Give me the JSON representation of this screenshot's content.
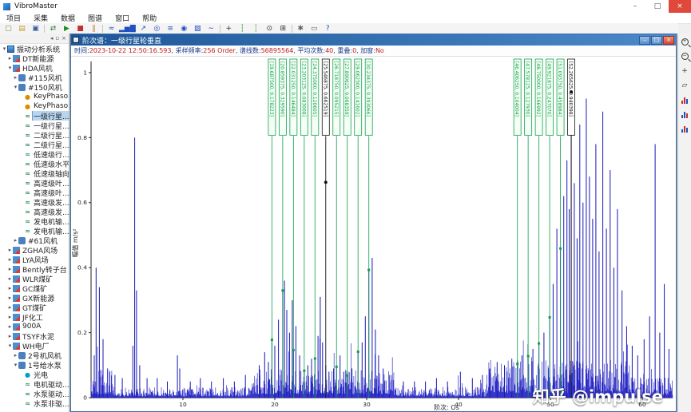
{
  "app": {
    "title": "VibroMaster"
  },
  "icons": {
    "minimize": "–",
    "maximize": "□",
    "close": "×",
    "expand_open": "▾",
    "expand_closed": "▸"
  },
  "menu": {
    "items": [
      "项目",
      "采集",
      "数据",
      "图谱",
      "窗口",
      "帮助"
    ]
  },
  "toolbar": {
    "items": [
      {
        "name": "new-project-icon",
        "glyph": "▢",
        "color": "#8a7a4a"
      },
      {
        "name": "open-project-icon",
        "glyph": "▤",
        "color": "#c89a3a"
      },
      {
        "name": "save-icon",
        "glyph": "▣",
        "color": "#3a5a9a"
      },
      {
        "sep": true
      },
      {
        "name": "connect-device-icon",
        "glyph": "⇄",
        "color": "#2a7a3a"
      },
      {
        "name": "start-acquisition-icon",
        "glyph": "▶",
        "color": "#1f8f1f"
      },
      {
        "name": "stop-acquisition-icon",
        "glyph": "■",
        "color": "#c03030"
      },
      {
        "name": "pause-acquisition-icon",
        "glyph": "‖",
        "color": "#c08030"
      },
      {
        "sep": true
      },
      {
        "name": "waveform-chart-icon",
        "glyph": "≈",
        "color": "#2050c0"
      },
      {
        "name": "spectrum-chart-icon",
        "glyph": "▂▅▇",
        "color": "#2050c0"
      },
      {
        "name": "trend-chart-icon",
        "glyph": "↗",
        "color": "#2050c0"
      },
      {
        "name": "orbit-chart-icon",
        "glyph": "◎",
        "color": "#2050c0"
      },
      {
        "name": "waterfall-chart-icon",
        "glyph": "≡",
        "color": "#2050c0"
      },
      {
        "name": "polar-chart-icon",
        "glyph": "◉",
        "color": "#2050c0"
      },
      {
        "name": "cascade-chart-icon",
        "glyph": "▨",
        "color": "#2050c0"
      },
      {
        "name": "bode-chart-icon",
        "glyph": "∼",
        "color": "#2050c0"
      },
      {
        "sep": true
      },
      {
        "name": "cursor-icon",
        "glyph": "+",
        "color": "#333333"
      },
      {
        "name": "harmonic-cursor-icon",
        "glyph": "┆",
        "color": "#1f8f1f"
      },
      {
        "name": "sideband-cursor-icon",
        "glyph": "┊",
        "color": "#1f8f1f"
      },
      {
        "name": "zoom-tool-icon",
        "glyph": "⊙",
        "color": "#333333"
      },
      {
        "name": "grid-icon",
        "glyph": "⊞",
        "color": "#333333"
      },
      {
        "sep": true
      },
      {
        "name": "settings-icon",
        "glyph": "✱",
        "color": "#666666"
      },
      {
        "name": "report-icon",
        "glyph": "▭",
        "color": "#666666"
      },
      {
        "name": "help-icon",
        "glyph": "?",
        "color": "#2050c0"
      }
    ]
  },
  "sidebar": {
    "header_icons": [
      {
        "name": "panel-back-icon",
        "glyph": "◂"
      },
      {
        "name": "panel-pin-icon",
        "glyph": "▫"
      },
      {
        "name": "panel-close-icon",
        "glyph": "×"
      }
    ],
    "tree": [
      {
        "label": "振动分析系统",
        "level": 0,
        "exp": "open",
        "icon": "root"
      },
      {
        "label": "DT新能源",
        "level": 1,
        "exp": "closed",
        "icon": "site"
      },
      {
        "label": "HDA风机",
        "level": 1,
        "exp": "open",
        "icon": "site"
      },
      {
        "label": "#115风机",
        "level": 2,
        "exp": "closed",
        "icon": "machine"
      },
      {
        "label": "#150风机",
        "level": 2,
        "exp": "open",
        "icon": "machine"
      },
      {
        "label": "KeyPhaso...",
        "level": 3,
        "exp": null,
        "icon": "key"
      },
      {
        "label": "KeyPhaso...",
        "level": 3,
        "exp": null,
        "icon": "key"
      },
      {
        "label": "一级行星...",
        "level": 3,
        "exp": null,
        "icon": "point",
        "selected": true
      },
      {
        "label": "一级行星...",
        "level": 3,
        "exp": null,
        "icon": "point"
      },
      {
        "label": "二级行星...",
        "level": 3,
        "exp": null,
        "icon": "point"
      },
      {
        "label": "二级行星...",
        "level": 3,
        "exp": null,
        "icon": "point"
      },
      {
        "label": "低速级行...",
        "level": 3,
        "exp": null,
        "icon": "point"
      },
      {
        "label": "低速级水平",
        "level": 3,
        "exp": null,
        "icon": "point"
      },
      {
        "label": "低速级轴向",
        "level": 3,
        "exp": null,
        "icon": "point"
      },
      {
        "label": "高速级叶...",
        "level": 3,
        "exp": null,
        "icon": "point"
      },
      {
        "label": "高速级叶...",
        "level": 3,
        "exp": null,
        "icon": "point"
      },
      {
        "label": "高速级发...",
        "level": 3,
        "exp": null,
        "icon": "point"
      },
      {
        "label": "高速级发...",
        "level": 3,
        "exp": null,
        "icon": "point"
      },
      {
        "label": "发电机输...",
        "level": 3,
        "exp": null,
        "icon": "point"
      },
      {
        "label": "发电机输...",
        "level": 3,
        "exp": null,
        "icon": "point"
      },
      {
        "label": "#61风机",
        "level": 2,
        "exp": "closed",
        "icon": "machine"
      },
      {
        "label": "ZGHA风场",
        "level": 1,
        "exp": "closed",
        "icon": "site"
      },
      {
        "label": "LYA风场",
        "level": 1,
        "exp": "closed",
        "icon": "site"
      },
      {
        "label": "Bently转子台",
        "level": 1,
        "exp": "closed",
        "icon": "site"
      },
      {
        "label": "WLR煤矿",
        "level": 1,
        "exp": "closed",
        "icon": "site"
      },
      {
        "label": "GC煤矿",
        "level": 1,
        "exp": "closed",
        "icon": "site"
      },
      {
        "label": "GX新能源",
        "level": 1,
        "exp": "closed",
        "icon": "site"
      },
      {
        "label": "GT煤矿",
        "level": 1,
        "exp": "closed",
        "icon": "site"
      },
      {
        "label": "JF化工",
        "level": 1,
        "exp": "closed",
        "icon": "site"
      },
      {
        "label": "900A",
        "level": 1,
        "exp": "closed",
        "icon": "site"
      },
      {
        "label": "TSYF水泥",
        "level": 1,
        "exp": "closed",
        "icon": "site"
      },
      {
        "label": "WH电厂",
        "level": 1,
        "exp": "open",
        "icon": "site"
      },
      {
        "label": "2号机风机",
        "level": 2,
        "exp": "closed",
        "icon": "machine"
      },
      {
        "label": "1号给水泵",
        "level": 2,
        "exp": "open",
        "icon": "machine"
      },
      {
        "label": "光电",
        "level": 3,
        "exp": null,
        "icon": "opt"
      },
      {
        "label": "电机驱动...",
        "level": 3,
        "exp": null,
        "icon": "point"
      },
      {
        "label": "水泵驱动...",
        "level": 3,
        "exp": null,
        "icon": "point"
      },
      {
        "label": "水泵非驱...",
        "level": 3,
        "exp": null,
        "icon": "point"
      }
    ]
  },
  "tree_icon_glyphs": {
    "point": "≈",
    "key": "●",
    "opt": "●"
  },
  "right_toolbar": {
    "items": [
      {
        "name": "zoom-in-icon",
        "kind": "mag",
        "sign": "+"
      },
      {
        "name": "zoom-out-icon",
        "kind": "mag",
        "sign": "−"
      },
      {
        "name": "pan-icon",
        "kind": "glyph",
        "glyph": "+",
        "color": "#333333"
      },
      {
        "name": "erase-marks-icon",
        "kind": "glyph",
        "glyph": "▱",
        "color": "#333333"
      },
      {
        "name": "chart-style-red-icon",
        "kind": "bars",
        "colors": [
          "#c03030",
          "#c03030",
          "#2050c0"
        ]
      },
      {
        "name": "chart-style-blue-icon",
        "kind": "bars",
        "colors": [
          "#2050c0",
          "#2050c0",
          "#c03030"
        ]
      },
      {
        "name": "chart-style-mixed-icon",
        "kind": "bars",
        "colors": [
          "#2050c0",
          "#c03030",
          "#2050c0"
        ]
      }
    ]
  },
  "doc": {
    "title": "阶次谱：一级行星轮垂直",
    "info": [
      {
        "label": "时间: ",
        "value": "2023-10-22 12:50:16.593"
      },
      {
        "label": ", 采样频率: ",
        "value": "256 Order"
      },
      {
        "label": ", 谱线数: ",
        "value": "56895564"
      },
      {
        "label": ", 平均次数: ",
        "value": "40"
      },
      {
        "label": ", 重叠: ",
        "value": "0"
      },
      {
        "label": ", 加窗: ",
        "value": "No"
      }
    ],
    "chart": {
      "type": "bar",
      "ylabel": "幅值 m/s²",
      "xlabel": "阶次: Os",
      "yticks": [
        "0",
        "0.2",
        "0.4",
        "0.6",
        "0.8",
        "1"
      ],
      "ytick_values": [
        0,
        0.2,
        0.4,
        0.6,
        0.8,
        1
      ],
      "xticks": [
        10,
        20,
        30,
        40,
        50,
        60
      ],
      "xmax": 63.3,
      "ymax": 1.0,
      "watermark": "知乎 @impulse",
      "noise_seed": 20231022,
      "noise_base": 0.017,
      "noise_bands": [
        {
          "from": 0,
          "to": 2.4,
          "base": 0.045
        },
        {
          "from": 17.5,
          "to": 33.0,
          "base": 0.045
        },
        {
          "from": 43.0,
          "to": 58.6,
          "base": 0.06
        },
        {
          "from": 58.6,
          "to": 63.4,
          "base": 0.032
        }
      ],
      "peaks": [
        [
          0.35,
          0.13
        ],
        [
          0.55,
          0.4
        ],
        [
          0.9,
          0.34
        ],
        [
          1.3,
          0.18
        ],
        [
          1.8,
          0.09
        ],
        [
          2.6,
          0.07
        ],
        [
          3.4,
          0.06
        ],
        [
          4.55,
          0.16
        ],
        [
          4.75,
          0.8
        ],
        [
          4.95,
          0.33
        ],
        [
          5.3,
          0.1
        ],
        [
          6.1,
          0.06
        ],
        [
          7.2,
          0.06
        ],
        [
          8.3,
          0.05
        ],
        [
          9.4,
          0.13
        ],
        [
          9.65,
          0.09
        ],
        [
          10.8,
          0.05
        ],
        [
          11.9,
          0.06
        ],
        [
          13.1,
          0.05
        ],
        [
          14.4,
          0.06
        ],
        [
          15.6,
          0.05
        ],
        [
          16.8,
          0.07
        ],
        [
          18.3,
          0.1
        ],
        [
          18.9,
          0.14
        ],
        [
          19.3,
          0.11
        ],
        [
          19.6875,
          0.178
        ],
        [
          20.0,
          0.16
        ],
        [
          20.4,
          0.24
        ],
        [
          20.859375,
          0.33
        ],
        [
          21.05,
          0.36
        ],
        [
          21.3,
          0.27
        ],
        [
          21.6,
          0.2
        ],
        [
          21.9,
          0.3
        ],
        [
          22.03125,
          0.146
        ],
        [
          22.3,
          0.22
        ],
        [
          22.7,
          0.13
        ],
        [
          23.203125,
          0.083
        ],
        [
          23.6,
          0.1
        ],
        [
          24.0,
          0.12
        ],
        [
          24.375,
          0.121
        ],
        [
          24.7,
          0.19
        ],
        [
          24.95,
          0.31
        ],
        [
          25.2,
          0.17
        ],
        [
          25.546875,
          0.1
        ],
        [
          25.9,
          0.08
        ],
        [
          26.4,
          0.09
        ],
        [
          26.71875,
          0.095
        ],
        [
          27.1,
          0.13
        ],
        [
          27.5,
          0.08
        ],
        [
          27.890625,
          0.068
        ],
        [
          28.4,
          0.09
        ],
        [
          29.0625,
          0.142
        ],
        [
          29.5,
          0.17
        ],
        [
          29.85,
          0.25
        ],
        [
          30.234375,
          0.393
        ],
        [
          30.6,
          0.43
        ],
        [
          30.95,
          0.21
        ],
        [
          31.3,
          0.13
        ],
        [
          31.8,
          0.09
        ],
        [
          32.5,
          0.07
        ],
        [
          34.0,
          0.05
        ],
        [
          35.2,
          0.05
        ],
        [
          36.4,
          0.05
        ],
        [
          37.6,
          0.06
        ],
        [
          38.8,
          0.05
        ],
        [
          40.2,
          0.08
        ],
        [
          41.5,
          0.06
        ],
        [
          42.6,
          0.07
        ],
        [
          43.4,
          0.09
        ],
        [
          44.2,
          0.11
        ],
        [
          45.0,
          0.1
        ],
        [
          45.8,
          0.12
        ],
        [
          46.40625,
          0.104
        ],
        [
          46.9,
          0.13
        ],
        [
          47.578125,
          0.128
        ],
        [
          48.1,
          0.15
        ],
        [
          48.75,
          0.167
        ],
        [
          49.3,
          0.2
        ],
        [
          49.921875,
          0.247
        ],
        [
          50.3,
          0.35
        ],
        [
          50.7,
          0.52
        ],
        [
          51.09375,
          0.459
        ],
        [
          51.45,
          0.62
        ],
        [
          51.8,
          0.73
        ],
        [
          52.05,
          0.58
        ],
        [
          52.265625,
          0.94
        ],
        [
          52.6,
          0.66
        ],
        [
          52.9,
          0.49
        ],
        [
          53.2,
          0.84
        ],
        [
          53.55,
          0.6
        ],
        [
          53.9,
          0.92
        ],
        [
          54.25,
          0.68
        ],
        [
          54.6,
          0.55
        ],
        [
          54.95,
          0.78
        ],
        [
          55.3,
          0.45
        ],
        [
          55.7,
          0.88
        ],
        [
          56.1,
          0.52
        ],
        [
          56.5,
          0.7
        ],
        [
          56.9,
          0.4
        ],
        [
          57.3,
          0.58
        ],
        [
          57.8,
          0.33
        ],
        [
          58.3,
          0.22
        ],
        [
          58.9,
          0.16
        ],
        [
          59.5,
          0.13
        ],
        [
          60.2,
          0.18
        ],
        [
          60.8,
          0.25
        ],
        [
          61.4,
          0.78
        ],
        [
          61.9,
          0.2
        ],
        [
          62.4,
          0.35
        ],
        [
          62.9,
          0.15
        ]
      ],
      "cursor_groups": [
        {
          "lines": [
            {
              "order": 19.6875,
              "amp": 0.178223,
              "label": "[19.687500, 0.178223]"
            },
            {
              "order": 20.859375,
              "amp": 0.32959,
              "label": "[20.859375, 0.329590]"
            },
            {
              "order": 22.03125,
              "amp": 0.146484,
              "label": "[22.031250, 0.146484]"
            },
            {
              "order": 23.203125,
              "amp": 0.083008,
              "label": "[23.203125, 0.083008]"
            },
            {
              "order": 24.375,
              "amp": 0.120605,
              "label": "[24.375000, 0.120605]"
            },
            {
              "order": 25.546875,
              "amp": 0.662519,
              "label": "[25.546875, 0.662519]",
              "black": true
            },
            {
              "order": 26.71875,
              "amp": 0.095215,
              "label": "[26.718750, 0.095215]"
            },
            {
              "order": 27.890625,
              "amp": 0.068359,
              "label": "[27.890625, 0.068359]"
            },
            {
              "order": 29.0625,
              "amp": 0.141602,
              "label": "[29.062500, 0.141602]"
            },
            {
              "order": 30.234375,
              "amp": 0.393066,
              "label": "[30.234375, 0.393066]"
            }
          ]
        },
        {
          "lines": [
            {
              "order": 46.40625,
              "amp": 0.104004,
              "label": "[46.406250, 0.104004]"
            },
            {
              "order": 47.578125,
              "amp": 0.12793,
              "label": "[47.578125, 0.127930]"
            },
            {
              "order": 48.75,
              "amp": 0.166992,
              "label": "[48.750000, 0.166992]"
            },
            {
              "order": 49.921875,
              "amp": 0.24707,
              "label": "[49.921875, 0.247070]"
            },
            {
              "order": 51.09375,
              "amp": 0.458984,
              "label": "[51.093750, 0.458984]"
            },
            {
              "order": 52.265625,
              "amp": 0.940398,
              "label": "[52.265625, 0.940398]",
              "black": true
            }
          ]
        }
      ]
    }
  }
}
